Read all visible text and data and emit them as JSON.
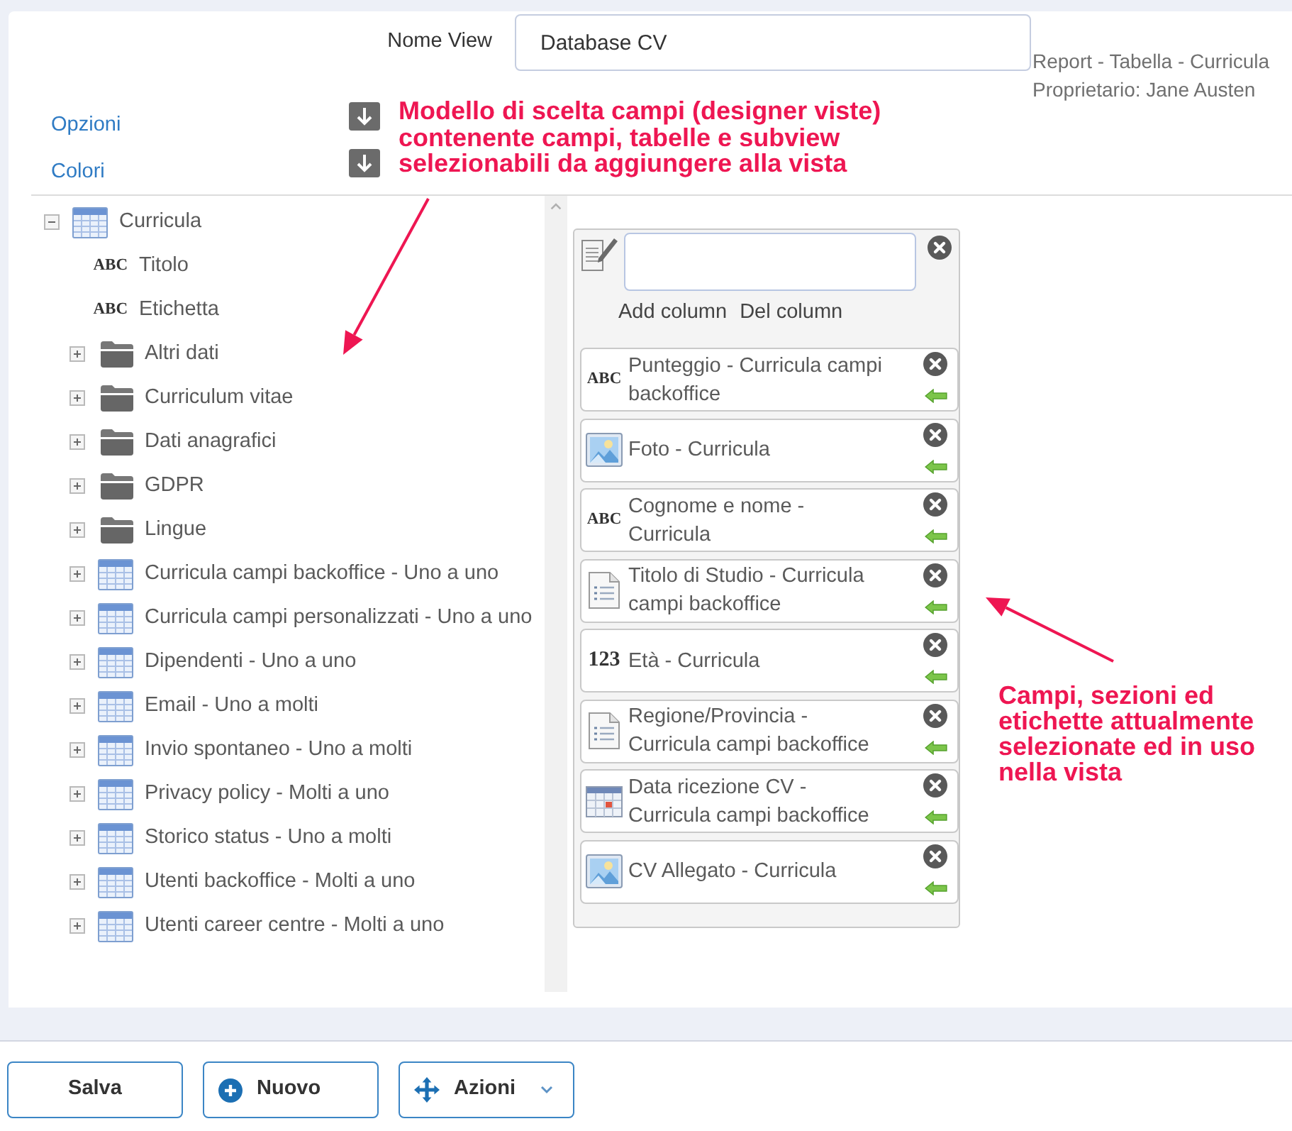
{
  "view_name": {
    "label": "Nome View",
    "value": "Database CV"
  },
  "view_info": [
    "Report - Tabella - Curricula",
    "Proprietario: Jane Austen"
  ],
  "options": [
    {
      "label": "Opzioni"
    },
    {
      "label": "Colori"
    }
  ],
  "annotations": [
    {
      "lines": [
        "Modello di scelta campi (designer viste)",
        "contenente campi, tabelle e subview",
        "selezionabili da aggiungere alla vista"
      ]
    },
    {
      "lines": [
        "Campi, sezioni ed",
        "etichette attualmente",
        "selezionate ed in uso",
        "nella vista"
      ]
    }
  ],
  "field_tree": [
    {
      "label": "Curricula",
      "kind": "table",
      "expanded": true,
      "children": [
        {
          "label": "Titolo",
          "kind": "text",
          "icon_label": "ABC"
        },
        {
          "label": "Etichetta",
          "kind": "text",
          "icon_label": "ABC"
        },
        {
          "label": "Altri dati",
          "kind": "folder",
          "expanded": false
        },
        {
          "label": "Curriculum vitae",
          "kind": "folder",
          "expanded": false
        },
        {
          "label": "Dati anagrafici",
          "kind": "folder",
          "expanded": false
        },
        {
          "label": "GDPR",
          "kind": "folder",
          "expanded": false
        },
        {
          "label": "Lingue",
          "kind": "folder",
          "expanded": false
        },
        {
          "label": "Curricula campi backoffice - Uno a uno",
          "kind": "table",
          "expanded": false
        },
        {
          "label": "Curricula campi personalizzati - Uno a uno",
          "kind": "table",
          "expanded": false
        },
        {
          "label": "Dipendenti - Uno a uno",
          "kind": "table",
          "expanded": false
        },
        {
          "label": "Email - Uno a molti",
          "kind": "table",
          "expanded": false
        },
        {
          "label": "Invio spontaneo - Uno a molti",
          "kind": "table",
          "expanded": false
        },
        {
          "label": "Privacy policy - Molti a uno",
          "kind": "table",
          "expanded": false
        },
        {
          "label": "Storico status - Uno a molti",
          "kind": "table",
          "expanded": false
        },
        {
          "label": "Utenti backoffice - Molti a uno",
          "kind": "table",
          "expanded": false
        },
        {
          "label": "Utenti career centre - Molti a uno",
          "kind": "table",
          "expanded": false
        }
      ]
    }
  ],
  "column_designer": {
    "actions": [
      "Add column",
      "Del column"
    ],
    "columns": [
      {
        "label": "Punteggio - Curricula campi backoffice",
        "kind": "text",
        "icon_label": "ABC"
      },
      {
        "label": "Foto - Curricula",
        "kind": "image"
      },
      {
        "label": "Cognome e nome - Curricula",
        "kind": "text",
        "icon_label": "ABC"
      },
      {
        "label": "Titolo di Studio - Curricula campi backoffice",
        "kind": "list"
      },
      {
        "label": "Età - Curricula",
        "kind": "number",
        "icon_label": "123"
      },
      {
        "label": "Regione/Provincia - Curricula campi backoffice",
        "kind": "list"
      },
      {
        "label": "Data ricezione CV - Curricula campi backoffice",
        "kind": "date"
      },
      {
        "label": "CV Allegato - Curricula",
        "kind": "image"
      }
    ]
  },
  "buttons": [
    {
      "label": "Salva",
      "kind": "save"
    },
    {
      "label": "Nuovo",
      "kind": "new"
    },
    {
      "label": "Azioni",
      "kind": "actions"
    }
  ]
}
